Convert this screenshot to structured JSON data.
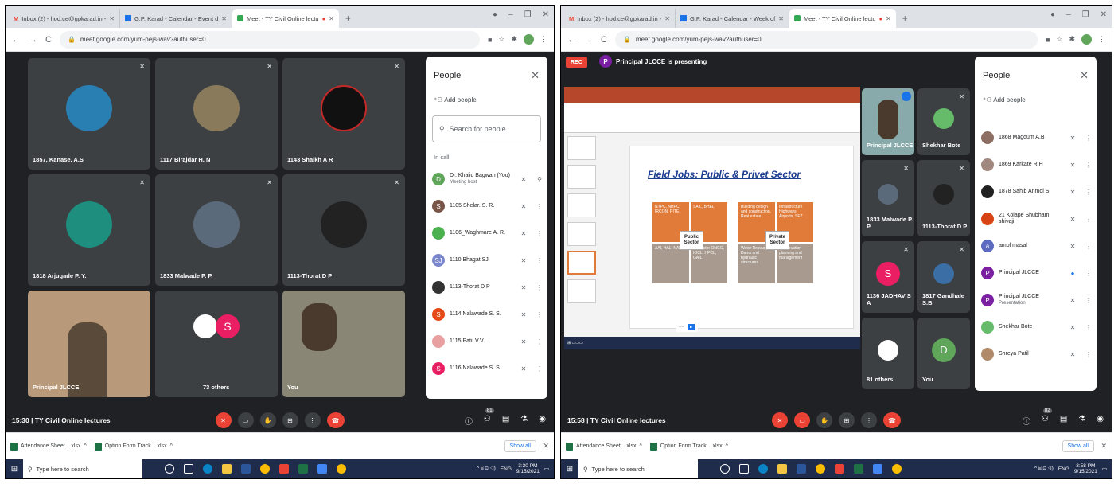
{
  "left": {
    "tabs": [
      {
        "label": "Inbox (2) - hod.ce@gpkarad.in -",
        "color": "#ea4335"
      },
      {
        "label": "G.P. Karad - Calendar - Event d",
        "color": "#1a73e8"
      },
      {
        "label": "Meet - TY Civil Online lectu",
        "color": "#34a853"
      }
    ],
    "url": "meet.google.com/yum-pejs-wav?authuser=0",
    "tiles": [
      {
        "name": "1857, Kanase. A.S"
      },
      {
        "name": "1117 Birajdar H. N"
      },
      {
        "name": "1143 Shaikh A R"
      },
      {
        "name": "1818 Arjugade P. Y."
      },
      {
        "name": "1833 Malwade P. P."
      },
      {
        "name": "1113-Thorat D P"
      },
      {
        "name": "Principal JLCCE"
      },
      {
        "name": "73 others"
      },
      {
        "name": "You"
      }
    ],
    "panel": {
      "title": "People",
      "add_people": "Add people",
      "search_placeholder": "Search for people",
      "in_call": "In call",
      "people": [
        {
          "name": "Dr. Khalid Bagwan (You)",
          "sub": "Meeting host",
          "initial": "D",
          "color": "#5fa55a"
        },
        {
          "name": "1105 Shelar. S. R.",
          "sub": "",
          "initial": "S",
          "color": "#795548"
        },
        {
          "name": "1106_Waghmare A. R.",
          "sub": "",
          "initial": "",
          "color": "#4caf50"
        },
        {
          "name": "1110 Bhagat SJ",
          "sub": "",
          "initial": "SJ",
          "color": "#7986cb"
        },
        {
          "name": "1113-Thorat D P",
          "sub": "",
          "initial": "",
          "color": "#333333"
        },
        {
          "name": "1114 Nalawade S. S.",
          "sub": "",
          "initial": "S",
          "color": "#e64a19"
        },
        {
          "name": "1115 Patil V.V.",
          "sub": "",
          "initial": "",
          "color": "#e8a0a0"
        },
        {
          "name": "1116 Nalawade S. S.",
          "sub": "",
          "initial": "S",
          "color": "#e91e63"
        }
      ]
    },
    "clock": "15:30",
    "meeting": "TY Civil Online lectures",
    "participant_count": "81",
    "downloads": [
      "Attendance Sheet....xlsx",
      "Option Form Track....xlsx"
    ],
    "show_all": "Show all",
    "taskbar_search": "Type here to search",
    "tray_lang": "ENG",
    "tray_time": "3:30 PM",
    "tray_date": "9/15/2021"
  },
  "right": {
    "tabs": [
      {
        "label": "Inbox (2) - hod.ce@gpkarad.in -",
        "color": "#ea4335"
      },
      {
        "label": "G.P. Karad - Calendar - Week of",
        "color": "#1a73e8"
      },
      {
        "label": "Meet - TY Civil Online lectu",
        "color": "#34a853"
      }
    ],
    "url": "meet.google.com/yum-pejs-wav?authuser=0",
    "rec": "REC",
    "presenter_initial": "P",
    "presenting": "Principal JLCCE is presenting",
    "slide": {
      "title": "Field Jobs: Public & Privet Sector",
      "public": "Public Sector",
      "private": "Private Sector",
      "b1": "NTPC, NHPC, IRCON, RITE",
      "b2": "SAIL, BHEL",
      "b3": "AAI, HAL, NAL",
      "b4": "Oil sector ONGC, IOCL, HPCL, GAIL",
      "b5": "Building design and construction, Real estate",
      "b6": "Infrastructure Highways, Airports, SEZ",
      "b7": "Water Resources Dams and hydraulic structures",
      "b8": "Construction planning and management"
    },
    "tiles": [
      {
        "name": "Principal JLCCE"
      },
      {
        "name": "Shekhar Bote"
      },
      {
        "name": "1833 Malwade P. P."
      },
      {
        "name": "1113-Thorat D P"
      },
      {
        "name": "1136 JADHAV S A"
      },
      {
        "name": "1817 Gandhale S.B"
      },
      {
        "name": "81 others"
      },
      {
        "name": "You"
      }
    ],
    "panel": {
      "title": "People",
      "add_people": "Add people",
      "people": [
        {
          "name": "1868 Magdum A.B",
          "sub": "",
          "initial": "",
          "color": "#8d6e63"
        },
        {
          "name": "1869 Karkate R.H",
          "sub": "",
          "initial": "",
          "color": "#a1887f"
        },
        {
          "name": "1878 Sahib Anmol S",
          "sub": "",
          "initial": "",
          "color": "#212121"
        },
        {
          "name": "21 Kolape Shubham shivaji",
          "sub": "",
          "initial": "",
          "color": "#d84315"
        },
        {
          "name": "amol masal",
          "sub": "",
          "initial": "a",
          "color": "#5c6bc0"
        },
        {
          "name": "Principal JLCCE",
          "sub": "",
          "initial": "P",
          "color": "#7b1fa2"
        },
        {
          "name": "Principal JLCCE",
          "sub": "Presentation",
          "initial": "P",
          "color": "#7b1fa2"
        },
        {
          "name": "Shekhar Bote",
          "sub": "",
          "initial": "",
          "color": "#66bb6a"
        },
        {
          "name": "Shreya Patil",
          "sub": "",
          "initial": "",
          "color": "#b08968"
        }
      ]
    },
    "clock": "15:58",
    "meeting": "TY Civil Online lectures",
    "participant_count": "82",
    "downloads": [
      "Attendance Sheet....xlsx",
      "Option Form Track....xlsx"
    ],
    "show_all": "Show all",
    "taskbar_search": "Type here to search",
    "tray_lang": "ENG",
    "tray_time": "3:58 PM",
    "tray_date": "9/15/2021"
  }
}
